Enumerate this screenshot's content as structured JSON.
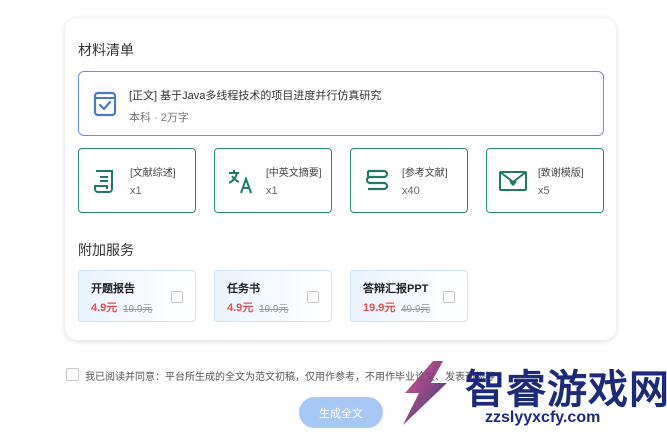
{
  "materials": {
    "title": "材料清单",
    "main": {
      "title": "[正文] 基于Java多线程技术的项目进度并行仿真研究",
      "subtitle": "本科 · 2万字",
      "icon": "document-check-icon"
    },
    "items": [
      {
        "label": "[文献综述]",
        "count": "x1",
        "icon": "scroll-document-icon"
      },
      {
        "label": "[中英文摘要]",
        "count": "x1",
        "icon": "translate-icon"
      },
      {
        "label": "[参考文献]",
        "count": "x40",
        "icon": "bookmark-list-icon"
      },
      {
        "label": "[致谢模版]",
        "count": "x5",
        "icon": "envelope-heart-icon"
      }
    ]
  },
  "services": {
    "title": "附加服务",
    "items": [
      {
        "name": "开题报告",
        "price": "4.9元",
        "original": "19.9元",
        "checked": false
      },
      {
        "name": "任务书",
        "price": "4.9元",
        "original": "19.9元",
        "checked": false
      },
      {
        "name": "答辩汇报PPT",
        "price": "19.9元",
        "original": "49.9元",
        "checked": false
      }
    ]
  },
  "agreement": {
    "text": "我已阅读并同意：平台所生成的全文为范文初稿，仅用作参考，不用作毕业论文、发表刊物等",
    "checked": false
  },
  "generate_button": "生成全文",
  "watermark": {
    "title": "智睿游戏网",
    "url": "zzslyyxcfy.com"
  },
  "colors": {
    "accent_blue": "#6a8fd8",
    "teal": "#2a8a7a",
    "price_red": "#e55050",
    "button_blue": "#a7c7f5"
  }
}
